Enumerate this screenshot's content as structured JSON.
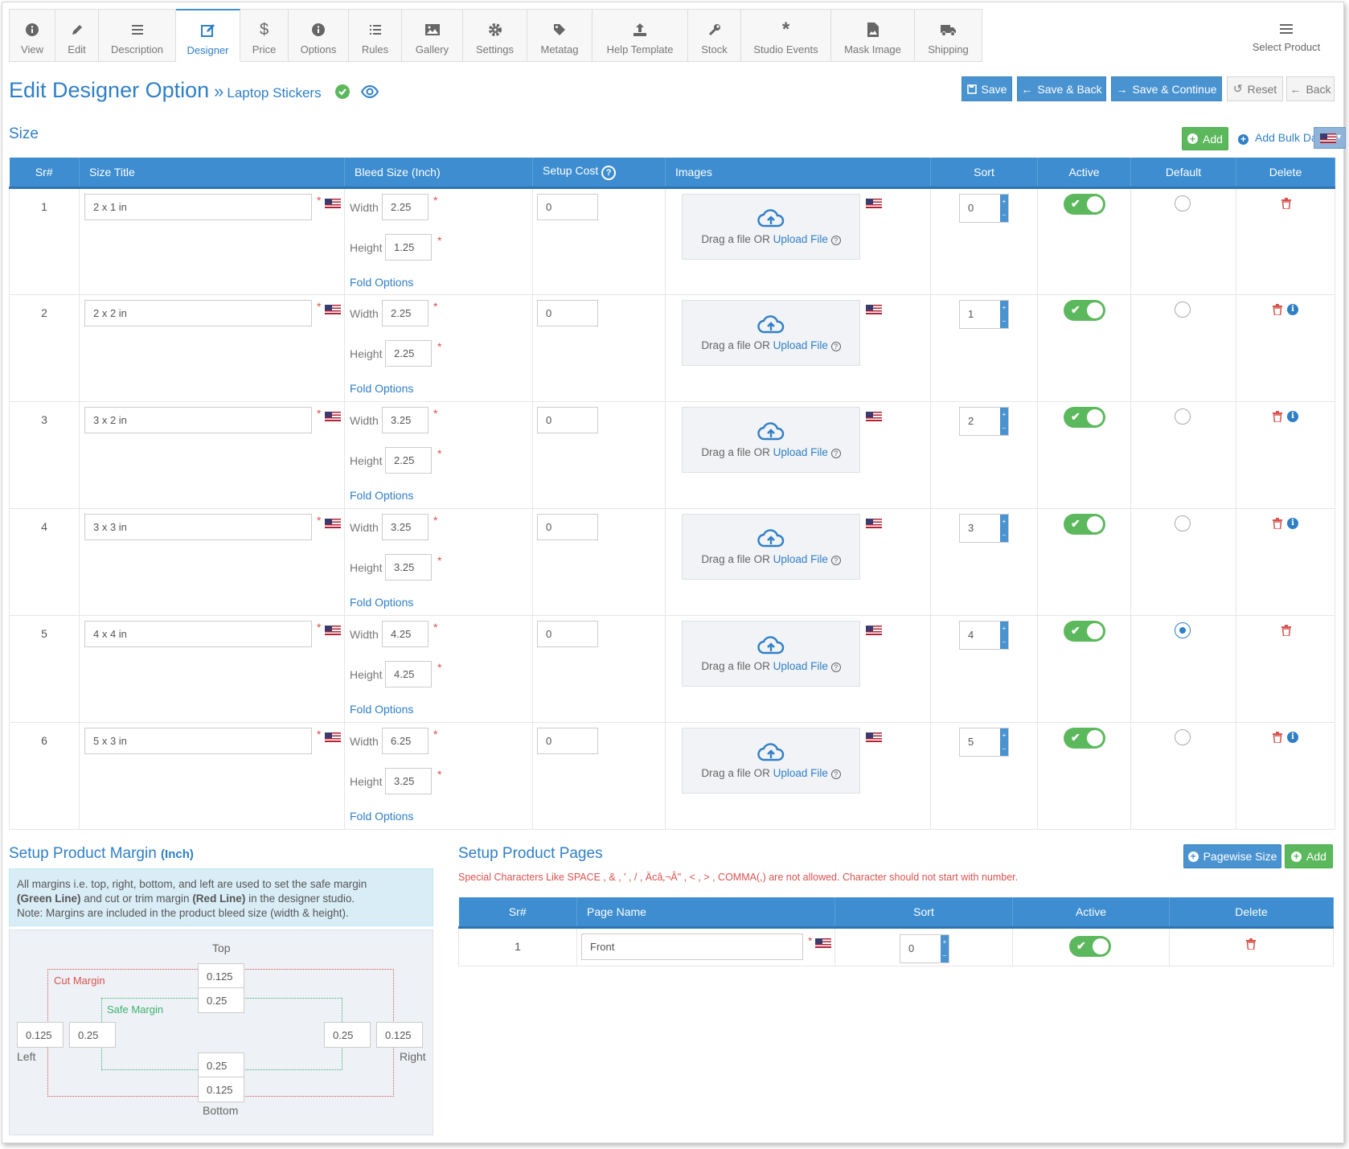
{
  "tabs": [
    {
      "label": "View",
      "icon": "info-icon"
    },
    {
      "label": "Edit",
      "icon": "pencil-icon"
    },
    {
      "label": "Description",
      "icon": "lines-icon"
    },
    {
      "label": "Designer",
      "icon": "edit-square-icon",
      "active": true
    },
    {
      "label": "Price",
      "icon": "dollar-icon"
    },
    {
      "label": "Options",
      "icon": "info-icon"
    },
    {
      "label": "Rules",
      "icon": "list-icon"
    },
    {
      "label": "Gallery",
      "icon": "image-icon"
    },
    {
      "label": "Settings",
      "icon": "gear-icon"
    },
    {
      "label": "Metatag",
      "icon": "tag-icon"
    },
    {
      "label": "Help Template",
      "icon": "upload-icon"
    },
    {
      "label": "Stock",
      "icon": "wrench-icon"
    },
    {
      "label": "Studio Events",
      "icon": "asterisk-icon"
    },
    {
      "label": "Mask Image",
      "icon": "file-image-icon"
    },
    {
      "label": "Shipping",
      "icon": "truck-icon"
    }
  ],
  "select_product": "Select Product",
  "header": {
    "title": "Edit Designer Option",
    "separator": "»",
    "subtitle": "Laptop Stickers"
  },
  "actions": {
    "save": "Save",
    "save_back": "Save & Back",
    "save_continue": "Save & Continue",
    "reset": "Reset",
    "back": "Back"
  },
  "size": {
    "title": "Size",
    "add": "Add",
    "add_bulk": "Add Bulk Da",
    "columns": [
      "Sr#",
      "Size Title",
      "Bleed Size (Inch)",
      "Setup Cost",
      "Images",
      "Sort",
      "Active",
      "Default",
      "Delete"
    ],
    "width_label": "Width",
    "height_label": "Height",
    "fold_options": "Fold Options",
    "drop_text": "Drag a file OR",
    "upload_text": "Upload File",
    "rows": [
      {
        "sr": "1",
        "title": "2 x 1 in",
        "width": "2.25",
        "height": "1.25",
        "setup_cost": "0",
        "sort": "0",
        "active": true,
        "default": false,
        "info": false
      },
      {
        "sr": "2",
        "title": "2 x 2 in",
        "width": "2.25",
        "height": "2.25",
        "setup_cost": "0",
        "sort": "1",
        "active": true,
        "default": false,
        "info": true
      },
      {
        "sr": "3",
        "title": "3 x 2 in",
        "width": "3.25",
        "height": "2.25",
        "setup_cost": "0",
        "sort": "2",
        "active": true,
        "default": false,
        "info": true
      },
      {
        "sr": "4",
        "title": "3 x 3 in",
        "width": "3.25",
        "height": "3.25",
        "setup_cost": "0",
        "sort": "3",
        "active": true,
        "default": false,
        "info": true
      },
      {
        "sr": "5",
        "title": "4 x 4 in",
        "width": "4.25",
        "height": "4.25",
        "setup_cost": "0",
        "sort": "4",
        "active": true,
        "default": true,
        "info": false
      },
      {
        "sr": "6",
        "title": "5 x 3 in",
        "width": "6.25",
        "height": "3.25",
        "setup_cost": "0",
        "sort": "5",
        "active": true,
        "default": false,
        "info": true
      }
    ]
  },
  "margin": {
    "title": "Setup Product Margin",
    "unit": "(Inch)",
    "note_a": "All margins i.e. top, right, bottom, and left are used to set the safe margin",
    "note_green": "(Green Line)",
    "note_b": " and cut or trim margin ",
    "note_red": "(Red Line)",
    "note_c": " in the designer studio.",
    "note_2": "Note: Margins are included in the product bleed size (width & height).",
    "top": "Top",
    "bottom": "Bottom",
    "left": "Left",
    "right": "Right",
    "cut_label": "Cut Margin",
    "safe_label": "Safe Margin",
    "top_cut": "0.125",
    "top_safe": "0.25",
    "left_cut": "0.125",
    "left_safe": "0.25",
    "right_safe": "0.25",
    "right_cut": "0.125",
    "bottom_safe": "0.25",
    "bottom_cut": "0.125"
  },
  "pages": {
    "title": "Setup Product Pages",
    "pagewise": "Pagewise Size",
    "add": "Add",
    "warning": "Special Characters Like SPACE , & , ' , / , Äcâ‚¬Â\" , < , > , COMMA(,) are not allowed. Character should not start with number.",
    "columns": [
      "Sr#",
      "Page Name",
      "Sort",
      "Active",
      "Delete"
    ],
    "rows": [
      {
        "sr": "1",
        "name": "Front",
        "sort": "0",
        "active": true
      }
    ]
  },
  "colors": {
    "primary": "#3d8dd0",
    "success": "#5cb85c",
    "danger": "#d9534f"
  }
}
